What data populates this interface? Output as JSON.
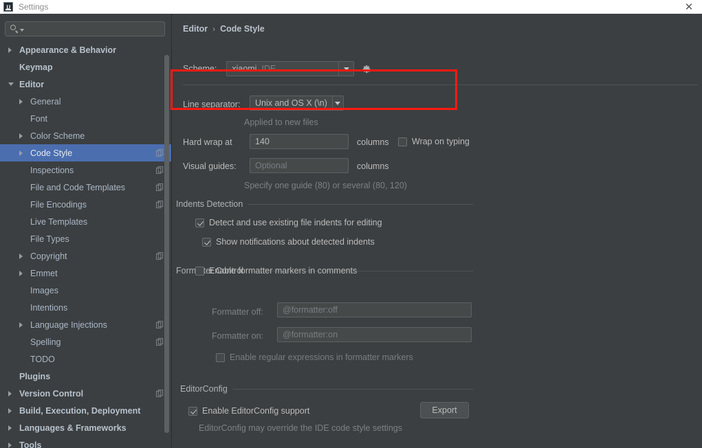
{
  "window": {
    "title": "Settings",
    "logo_text": "IJ",
    "close_icon": "✕"
  },
  "sidebar": {
    "search": {
      "value": "",
      "placeholder": ""
    },
    "items": [
      {
        "label": "Appearance & Behavior",
        "indent": 0,
        "arrow": "collapsed",
        "bold": true,
        "badge": false,
        "selected": false
      },
      {
        "label": "Keymap",
        "indent": 0,
        "arrow": "none",
        "bold": true,
        "badge": false,
        "selected": false
      },
      {
        "label": "Editor",
        "indent": 0,
        "arrow": "expanded",
        "bold": true,
        "badge": false,
        "selected": false
      },
      {
        "label": "General",
        "indent": 1,
        "arrow": "collapsed",
        "bold": false,
        "badge": false,
        "selected": false
      },
      {
        "label": "Font",
        "indent": 1,
        "arrow": "none",
        "bold": false,
        "badge": false,
        "selected": false
      },
      {
        "label": "Color Scheme",
        "indent": 1,
        "arrow": "collapsed",
        "bold": false,
        "badge": false,
        "selected": false
      },
      {
        "label": "Code Style",
        "indent": 1,
        "arrow": "collapsed",
        "bold": false,
        "badge": true,
        "selected": true
      },
      {
        "label": "Inspections",
        "indent": 1,
        "arrow": "none",
        "bold": false,
        "badge": true,
        "selected": false
      },
      {
        "label": "File and Code Templates",
        "indent": 1,
        "arrow": "none",
        "bold": false,
        "badge": true,
        "selected": false
      },
      {
        "label": "File Encodings",
        "indent": 1,
        "arrow": "none",
        "bold": false,
        "badge": true,
        "selected": false
      },
      {
        "label": "Live Templates",
        "indent": 1,
        "arrow": "none",
        "bold": false,
        "badge": false,
        "selected": false
      },
      {
        "label": "File Types",
        "indent": 1,
        "arrow": "none",
        "bold": false,
        "badge": false,
        "selected": false
      },
      {
        "label": "Copyright",
        "indent": 1,
        "arrow": "collapsed",
        "bold": false,
        "badge": true,
        "selected": false
      },
      {
        "label": "Emmet",
        "indent": 1,
        "arrow": "collapsed",
        "bold": false,
        "badge": false,
        "selected": false
      },
      {
        "label": "Images",
        "indent": 1,
        "arrow": "none",
        "bold": false,
        "badge": false,
        "selected": false
      },
      {
        "label": "Intentions",
        "indent": 1,
        "arrow": "none",
        "bold": false,
        "badge": false,
        "selected": false
      },
      {
        "label": "Language Injections",
        "indent": 1,
        "arrow": "collapsed",
        "bold": false,
        "badge": true,
        "selected": false
      },
      {
        "label": "Spelling",
        "indent": 1,
        "arrow": "none",
        "bold": false,
        "badge": true,
        "selected": false
      },
      {
        "label": "TODO",
        "indent": 1,
        "arrow": "none",
        "bold": false,
        "badge": false,
        "selected": false
      },
      {
        "label": "Plugins",
        "indent": 0,
        "arrow": "none",
        "bold": true,
        "badge": false,
        "selected": false
      },
      {
        "label": "Version Control",
        "indent": 0,
        "arrow": "collapsed",
        "bold": true,
        "badge": true,
        "selected": false
      },
      {
        "label": "Build, Execution, Deployment",
        "indent": 0,
        "arrow": "collapsed",
        "bold": true,
        "badge": false,
        "selected": false
      },
      {
        "label": "Languages & Frameworks",
        "indent": 0,
        "arrow": "collapsed",
        "bold": true,
        "badge": false,
        "selected": false
      },
      {
        "label": "Tools",
        "indent": 0,
        "arrow": "collapsed",
        "bold": true,
        "badge": false,
        "selected": false
      }
    ]
  },
  "content": {
    "breadcrumb": {
      "parent": "Editor",
      "separator": "›",
      "current": "Code Style"
    },
    "scheme": {
      "label": "Scheme:",
      "value": "xiaomi",
      "value_suffix": "IDE",
      "gear_icon": "gear-icon"
    },
    "line_separator": {
      "label": "Line separator:",
      "value": "Unix and OS X (\\n)",
      "hint": "Applied to new files"
    },
    "hard_wrap": {
      "label": "Hard wrap at",
      "value": "140",
      "unit": "columns",
      "wrap_on_typing_label": "Wrap on typing",
      "wrap_on_typing_checked": false
    },
    "visual_guides": {
      "label": "Visual guides:",
      "placeholder": "Optional",
      "unit": "columns",
      "hint": "Specify one guide (80) or several (80, 120)"
    },
    "indents_detection": {
      "title": "Indents Detection",
      "detect_label": "Detect and use existing file indents for editing",
      "detect_checked": true,
      "notify_label": "Show notifications about detected indents",
      "notify_checked": true
    },
    "formatter_control": {
      "title": "Formatter Control",
      "enable_markers_label": "Enable formatter markers in comments",
      "enable_markers_checked": false,
      "formatter_off_label": "Formatter off:",
      "formatter_off_value": "@formatter:off",
      "formatter_on_label": "Formatter on:",
      "formatter_on_value": "@formatter:on",
      "regex_label": "Enable regular expressions in formatter markers",
      "regex_checked": false
    },
    "editorconfig": {
      "title": "EditorConfig",
      "enable_label": "Enable EditorConfig support",
      "enable_checked": true,
      "export_button": "Export",
      "hint": "EditorConfig may override the IDE code style settings"
    }
  },
  "annotation": {
    "color": "#ff1a11"
  }
}
